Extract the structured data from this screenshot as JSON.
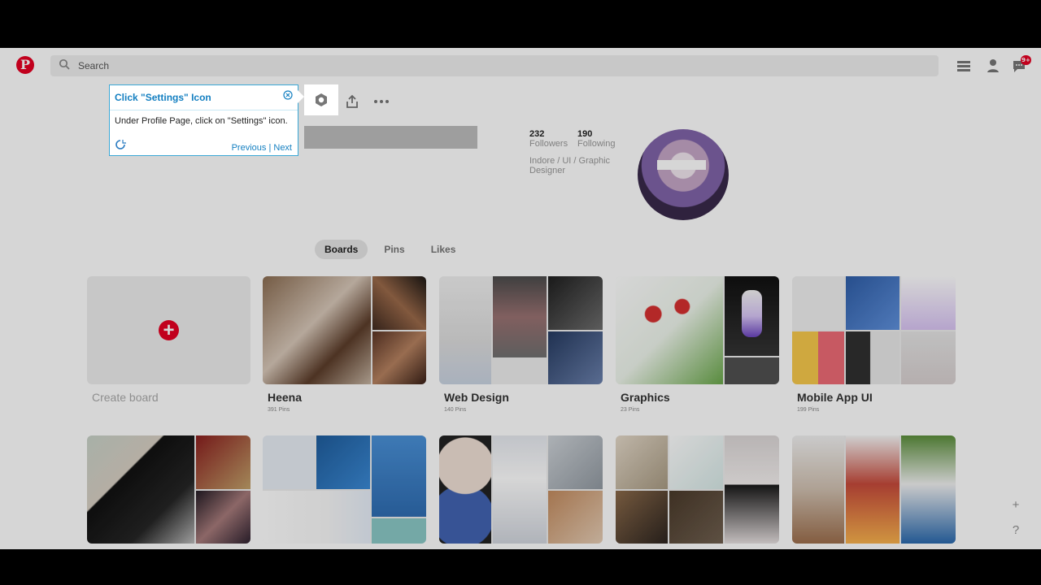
{
  "header": {
    "logo": "P",
    "search_placeholder": "Search",
    "notification_count": "9+"
  },
  "profile": {
    "followers_count": "232",
    "followers_label": "Followers",
    "following_count": "190",
    "following_label": "Following",
    "bio": "Indore / UI / Graphic Designer"
  },
  "tabs": [
    {
      "label": "Boards"
    },
    {
      "label": "Pins"
    },
    {
      "label": "Likes"
    }
  ],
  "boards": [
    {
      "title": "Create board",
      "count": ""
    },
    {
      "title": "Heena",
      "count": "391 Pins"
    },
    {
      "title": "Web Design",
      "count": "140 Pins"
    },
    {
      "title": "Graphics",
      "count": "23 Pins"
    },
    {
      "title": "Mobile App UI",
      "count": "199 Pins"
    }
  ],
  "tooltip": {
    "title": "Click \"Settings\" Icon",
    "body": "Under Profile Page, click on \"Settings\" icon.",
    "previous": "Previous",
    "separator": "|",
    "next": "Next"
  },
  "floating": {
    "add": "+",
    "help": "?"
  },
  "colors": {
    "brand": "#e60023",
    "tour_accent": "#137fc1",
    "tour_border": "#3aa7d6"
  }
}
